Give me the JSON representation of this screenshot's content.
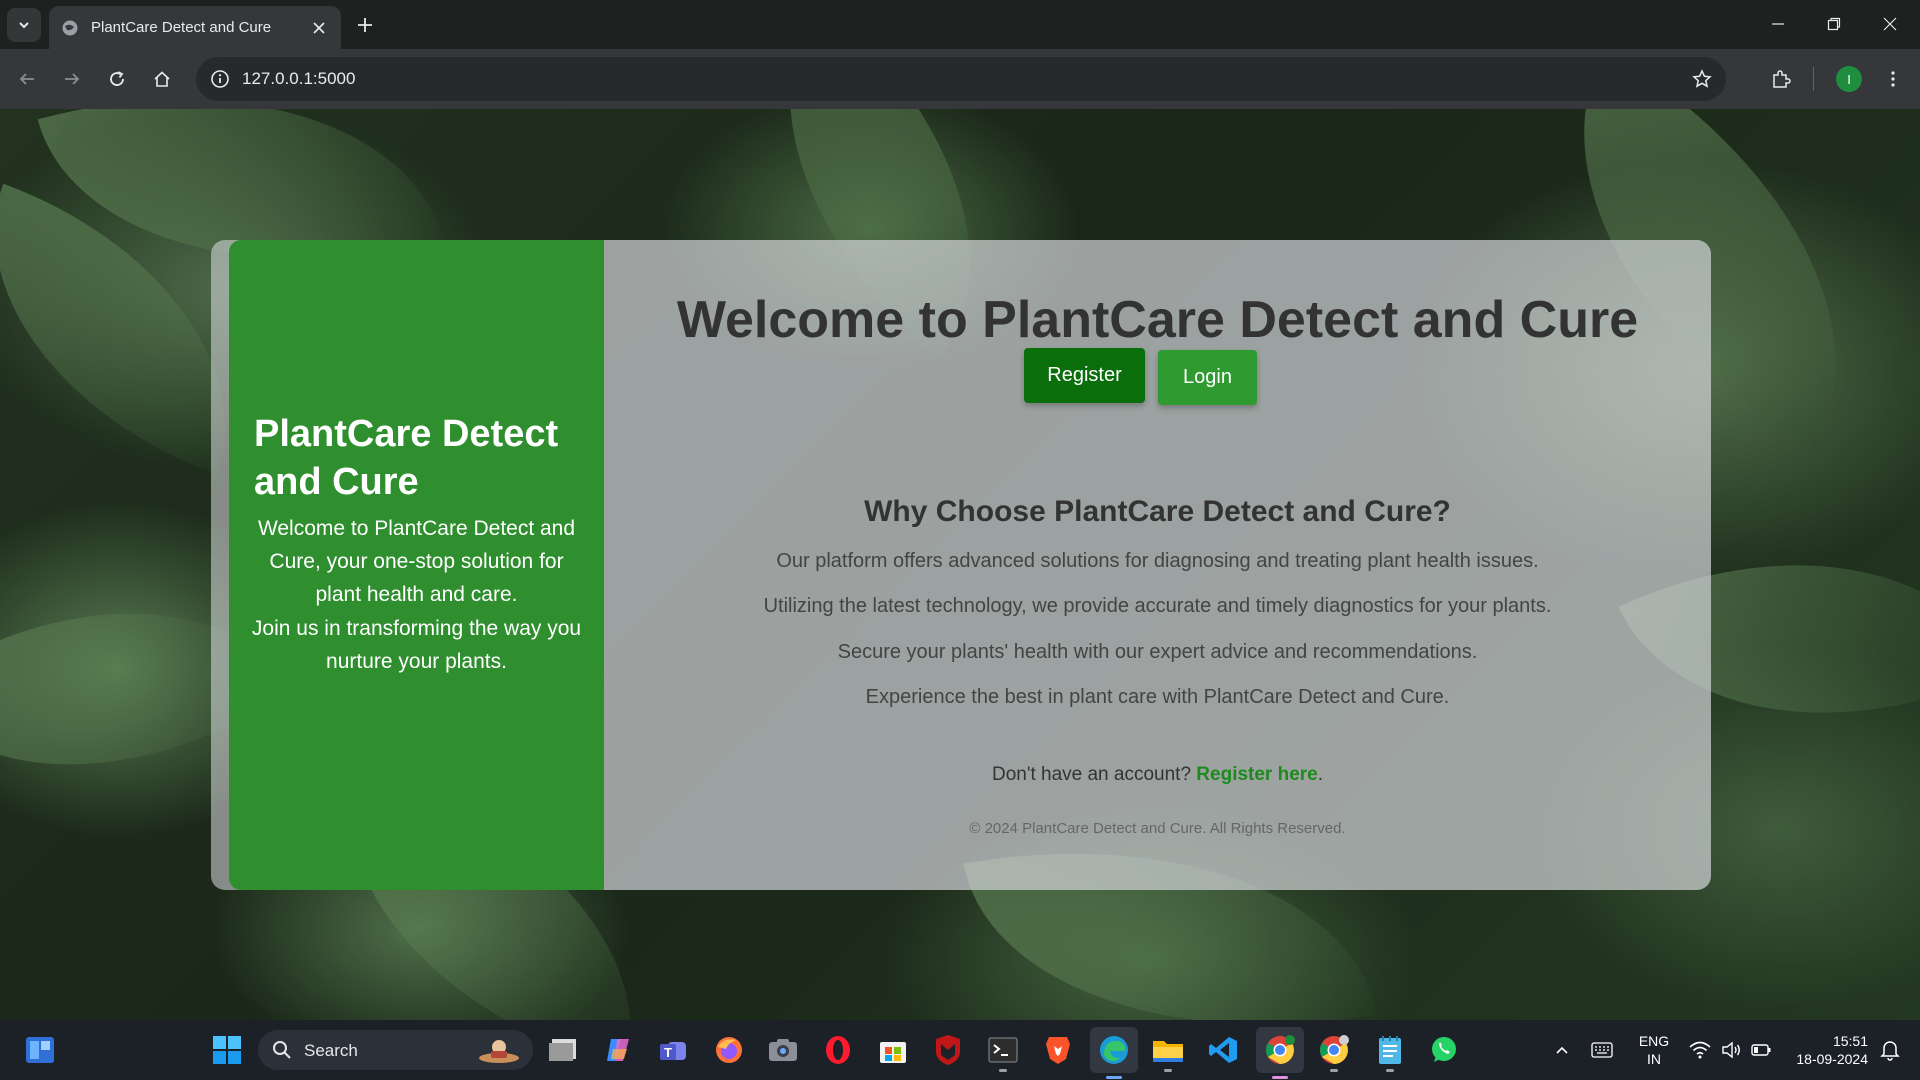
{
  "browser": {
    "tab_title": "PlantCare Detect and Cure",
    "url": "127.0.0.1:5000",
    "profile_initial": "I"
  },
  "page": {
    "sidebar": {
      "title": "PlantCare Detect and Cure",
      "intro": "Welcome to PlantCare Detect and Cure, your one-stop solution for plant health and care.",
      "join": "Join us in transforming the way you nurture your plants."
    },
    "main": {
      "title": "Welcome to PlantCare Detect and Cure",
      "register_label": "Register",
      "login_label": "Login",
      "why_title": "Why Choose PlantCare Detect and Cure?",
      "points": [
        "Our platform offers advanced solutions for diagnosing and treating plant health issues.",
        "Utilizing the latest technology, we provide accurate and timely diagnostics for your plants.",
        "Secure your plants' health with our expert advice and recommendations.",
        "Experience the best in plant care with PlantCare Detect and Cure."
      ],
      "account_prompt": "Don't have an account?",
      "register_link": "Register here",
      "account_suffix": ".",
      "footer": "© 2024 PlantCare Detect and Cure. All Rights Reserved."
    },
    "colors": {
      "sidebar_green": "#2f8f2f",
      "register_button": "#0a6e0a",
      "login_button": "#2f9a2f",
      "link_green": "#1e8a1e"
    }
  },
  "taskbar": {
    "search_placeholder": "Search",
    "language_top": "ENG",
    "language_bottom": "IN",
    "time": "15:51",
    "date": "18-09-2024",
    "apps": [
      "file-explorer-icon",
      "copilot-icon",
      "teams-icon",
      "firefox-icon",
      "camera-icon",
      "opera-icon",
      "microsoft-store-icon",
      "mcafee-icon",
      "terminal-icon",
      "brave-icon",
      "edge-icon",
      "folder-icon",
      "vscode-icon",
      "chrome-icon",
      "chrome-profile-icon",
      "notepad-icon",
      "whatsapp-icon"
    ]
  }
}
